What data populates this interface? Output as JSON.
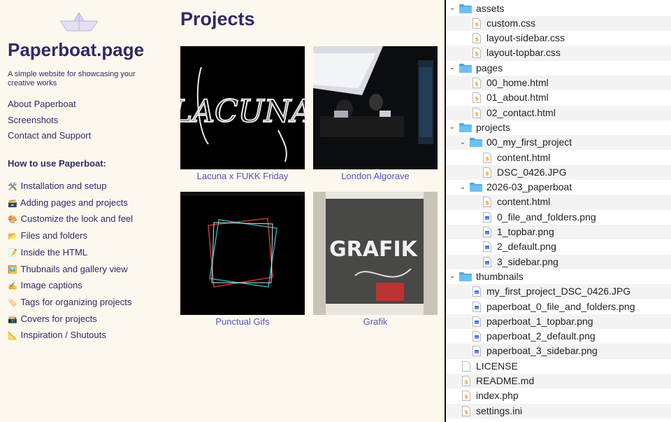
{
  "site": {
    "title": "Paperboat.page",
    "tagline": "A simple website for showcasing your creative works",
    "nav": [
      {
        "label": "About Paperboat"
      },
      {
        "label": "Screenshots"
      },
      {
        "label": "Contact and Support"
      }
    ],
    "howto_heading": "How to use Paperboat:",
    "howto": [
      {
        "emoji": "🛠️",
        "label": "Installation and setup"
      },
      {
        "emoji": "🗃️",
        "label": "Adding pages and projects"
      },
      {
        "emoji": "🎨",
        "label": "Customize the look and feel"
      },
      {
        "emoji": "📂",
        "label": "Files and folders"
      },
      {
        "emoji": "📝",
        "label": "Inside the HTML"
      },
      {
        "emoji": "🖼️",
        "label": "Thubnails and gallery view"
      },
      {
        "emoji": "✍️",
        "label": "Image captions"
      },
      {
        "emoji": "🏷️",
        "label": "Tags for organizing projects"
      },
      {
        "emoji": "📸",
        "label": "Covers for projects"
      },
      {
        "emoji": "📐",
        "label": "Inspiration / Shutouts"
      }
    ],
    "projects_title": "Projects",
    "projects": [
      {
        "caption": "Lacuna x FUKK Friday",
        "thumb_word": "LACUNA"
      },
      {
        "caption": "London Algorave"
      },
      {
        "caption": "Punctual Gifs"
      },
      {
        "caption": "Grafik",
        "thumb_word": "GRAFIK"
      }
    ],
    "colors": {
      "accent": "#2f2a66",
      "link": "#5a4fc0",
      "background": "#fdf8ee"
    }
  },
  "tree": [
    {
      "type": "folder",
      "name": "assets",
      "expanded": true,
      "depth": 0
    },
    {
      "type": "file",
      "name": "custom.css",
      "icon": "code",
      "depth": 1
    },
    {
      "type": "file",
      "name": "layout-sidebar.css",
      "icon": "code",
      "depth": 1
    },
    {
      "type": "file",
      "name": "layout-topbar.css",
      "icon": "code",
      "depth": 1
    },
    {
      "type": "folder",
      "name": "pages",
      "expanded": true,
      "depth": 0
    },
    {
      "type": "file",
      "name": "00_home.html",
      "icon": "code",
      "depth": 1
    },
    {
      "type": "file",
      "name": "01_about.html",
      "icon": "code",
      "depth": 1
    },
    {
      "type": "file",
      "name": "02_contact.html",
      "icon": "code",
      "depth": 1
    },
    {
      "type": "folder",
      "name": "projects",
      "expanded": true,
      "depth": 0
    },
    {
      "type": "folder",
      "name": "00_my_first_project",
      "expanded": true,
      "depth": 1
    },
    {
      "type": "file",
      "name": "content.html",
      "icon": "code",
      "depth": 2
    },
    {
      "type": "file",
      "name": "DSC_0426.JPG",
      "icon": "code",
      "depth": 2
    },
    {
      "type": "folder",
      "name": "2026-03_paperboat",
      "expanded": true,
      "depth": 1
    },
    {
      "type": "file",
      "name": "content.html",
      "icon": "code",
      "depth": 2
    },
    {
      "type": "file",
      "name": "0_file_and_folders.png",
      "icon": "image",
      "depth": 2
    },
    {
      "type": "file",
      "name": "1_topbar.png",
      "icon": "image",
      "depth": 2
    },
    {
      "type": "file",
      "name": "2_default.png",
      "icon": "image",
      "depth": 2
    },
    {
      "type": "file",
      "name": "3_sidebar.png",
      "icon": "image",
      "depth": 2
    },
    {
      "type": "folder",
      "name": "thumbnails",
      "expanded": true,
      "depth": 0
    },
    {
      "type": "file",
      "name": "my_first_project_DSC_0426.JPG",
      "icon": "image",
      "depth": 1
    },
    {
      "type": "file",
      "name": "paperboat_0_file_and_folders.png",
      "icon": "image",
      "depth": 1
    },
    {
      "type": "file",
      "name": "paperboat_1_topbar.png",
      "icon": "image",
      "depth": 1
    },
    {
      "type": "file",
      "name": "paperboat_2_default.png",
      "icon": "image",
      "depth": 1
    },
    {
      "type": "file",
      "name": "paperboat_3_sidebar.png",
      "icon": "image",
      "depth": 1
    },
    {
      "type": "file",
      "name": "LICENSE",
      "icon": "blank",
      "depth": 0
    },
    {
      "type": "file",
      "name": "README.md",
      "icon": "code",
      "depth": 0
    },
    {
      "type": "file",
      "name": "index.php",
      "icon": "code",
      "depth": 0
    },
    {
      "type": "file",
      "name": "settings.ini",
      "icon": "code",
      "depth": 0
    }
  ]
}
